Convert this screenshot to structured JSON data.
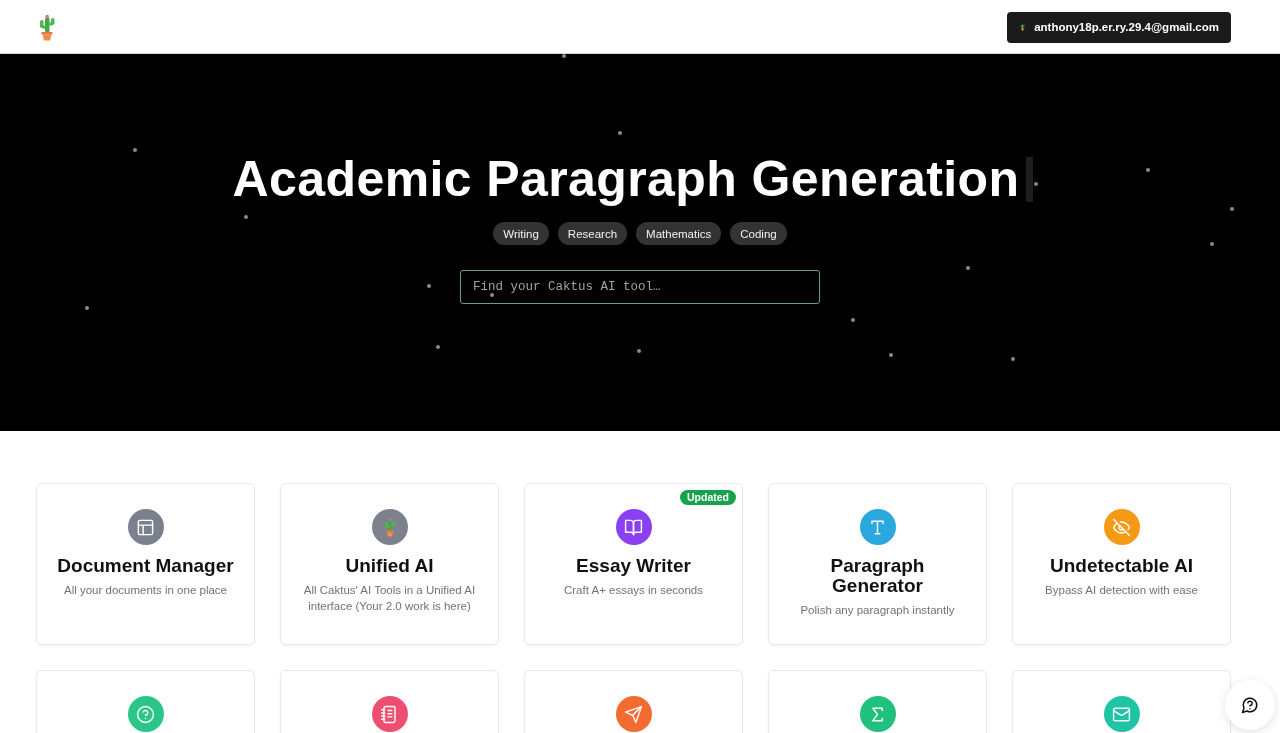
{
  "header": {
    "account_email": "anthony18p.er.ry.29.4@gmail.com"
  },
  "hero": {
    "title": "Academic Paragraph Generation",
    "categories": [
      "Writing",
      "Research",
      "Mathematics",
      "Coding"
    ],
    "search": {
      "placeholder": "Find your Caktus AI tool…"
    }
  },
  "tools": [
    {
      "title": "Document Manager",
      "description": "All your documents in one place",
      "color": "#7b808e"
    },
    {
      "title": "Unified AI",
      "description": "All Caktus' AI Tools in a Unified AI interface (Your 2.0 work is here)",
      "color": "#7d818c"
    },
    {
      "title": "Essay Writer",
      "description": "Craft A+ essays in seconds",
      "color": "#8a3ff0",
      "badge": "Updated"
    },
    {
      "title": "Paragraph Generator",
      "description": "Polish any paragraph instantly",
      "color": "#2ba9de"
    },
    {
      "title": "Undetectable AI",
      "description": "Bypass AI detection with ease",
      "color": "#f59a14"
    },
    {
      "color": "#2bc58a"
    },
    {
      "color": "#ee4f6e"
    },
    {
      "color": "#f26b30"
    },
    {
      "color": "#20c07f"
    },
    {
      "color": "#1fc4a4"
    }
  ]
}
